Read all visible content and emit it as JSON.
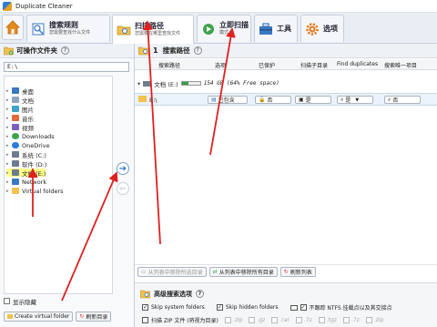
{
  "window": {
    "title": "Duplicate Cleaner"
  },
  "ribbon": {
    "tabs": [
      {
        "title": "搜索规则",
        "subtitle": "您需要查找什么文件"
      },
      {
        "title": "扫描路径",
        "subtitle": "您需要在哪里查找文件"
      },
      {
        "title": "立即扫描",
        "subtitle": "模式"
      },
      {
        "title": "工具",
        "subtitle": ""
      },
      {
        "title": "选项",
        "subtitle": ""
      }
    ]
  },
  "left_panel": {
    "header": "可操作文件夹",
    "help": "?",
    "path": "E:\\",
    "tree": [
      "桌面",
      "文档",
      "图片",
      "音乐",
      "视频",
      "Downloads",
      "OneDrive",
      "系统 (C:)",
      "软件 (D:)",
      "文档 (E:)",
      "Network",
      "Virtual folders"
    ],
    "show_hidden": "显示隐藏",
    "create_virtual_folder": "Create virtual folder",
    "refresh_dirs": "刷新目录"
  },
  "middle": {
    "add": "➔",
    "remove": "⇐"
  },
  "right_panel": {
    "number": "1",
    "header": "搜索路径",
    "help": "?",
    "columns": [
      "搜索路径",
      "选项",
      "已保护",
      "扫描子目录",
      "Find duplicates",
      "搜索唯一项目"
    ],
    "drive_label": "文档 (E:)",
    "drive_info": "154 GB (64% Free space)",
    "drive_used_fraction": 0.36,
    "folder_path": "E:\\",
    "included": "已包含",
    "no_label": "否",
    "yes_label": "是",
    "actions": [
      "从列表中移除所选目录",
      "从列表中移除所有目录",
      "刷新列表"
    ]
  },
  "advanced": {
    "title": "高级搜索选项",
    "help": "?",
    "skip_system": "Skip system folders",
    "skip_hidden": "Skip hidden folders",
    "ntfs": "不跟踪 NTFS 挂载点以及其交接点",
    "zip": "扫描 ZIP 文件 (将视为目录)",
    "exts": [
      ".zip",
      ".gz",
      ".rar",
      ".7z",
      ".tgz",
      ".7z",
      ".zip"
    ]
  },
  "colors": {
    "accent": "#2a7ac0",
    "annotation": "#e02020",
    "highlight": "#ffff88"
  }
}
